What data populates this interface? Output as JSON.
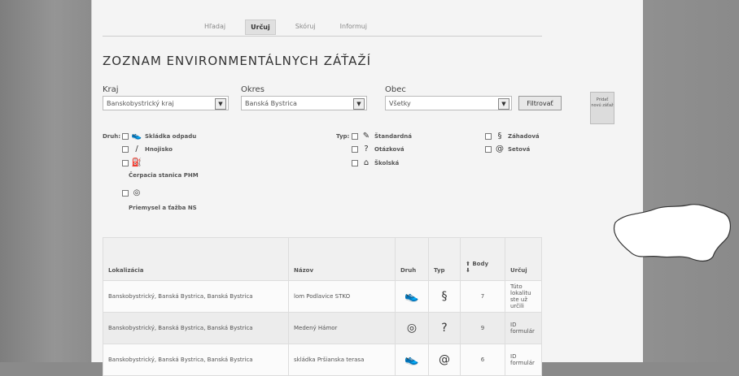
{
  "nav": {
    "tabs": [
      "Hľadaj",
      "Určuj",
      "Skóruj",
      "Informuj"
    ],
    "active": 1
  },
  "page": {
    "title": "ZOZNAM ENVIRONMENTÁLNYCH ZÁŤAŽÍ"
  },
  "filters": {
    "kraj_label": "Kraj",
    "kraj_value": "Banskobystrický kraj",
    "okres_label": "Okres",
    "okres_value": "Banská Bystrica",
    "obec_label": "Obec",
    "obec_value": "Všetky",
    "filter_button": "Filtrovať",
    "add_button": "Pridať novú záťaž"
  },
  "druh": {
    "label": "Druh:",
    "items": [
      "Skládka odpadu",
      "Hnojisko",
      "Čerpacia stanica PHM",
      "Priemysel a ťažba NS"
    ]
  },
  "typ": {
    "label": "Typ:",
    "items": [
      "Štandardná",
      "Otázková",
      "Školská",
      "Záhadová",
      "Setová"
    ]
  },
  "table": {
    "headers": [
      "Lokalizácia",
      "Názov",
      "Druh",
      "Typ",
      "Body",
      "Určuj"
    ],
    "rows": [
      {
        "lok": "Banskobystrický, Banská Bystrica, Banská Bystrica",
        "nazov": "lom Podlavice STKO",
        "body": "7",
        "urcuj": "Túto lokalitu ste už určili"
      },
      {
        "lok": "Banskobystrický, Banská Bystrica, Banská Bystrica",
        "nazov": "Medený Hámor",
        "body": "9",
        "urcuj": "ID formulár"
      },
      {
        "lok": "Banskobystrický, Banská Bystrica, Banská Bystrica",
        "nazov": "skládka Pršianska terasa",
        "body": "6",
        "urcuj": "ID formulár"
      }
    ]
  },
  "icons": {
    "skladka": "shoe-icon",
    "hnojisko": "slash-icon",
    "cerpacia": "fuel-icon",
    "priemysel": "target-icon",
    "standardna": "broom-icon",
    "otazkova": "question-bubble-icon",
    "skolska": "school-icon",
    "zahadova": "swirl-icon",
    "setova": "spiral-icon"
  }
}
